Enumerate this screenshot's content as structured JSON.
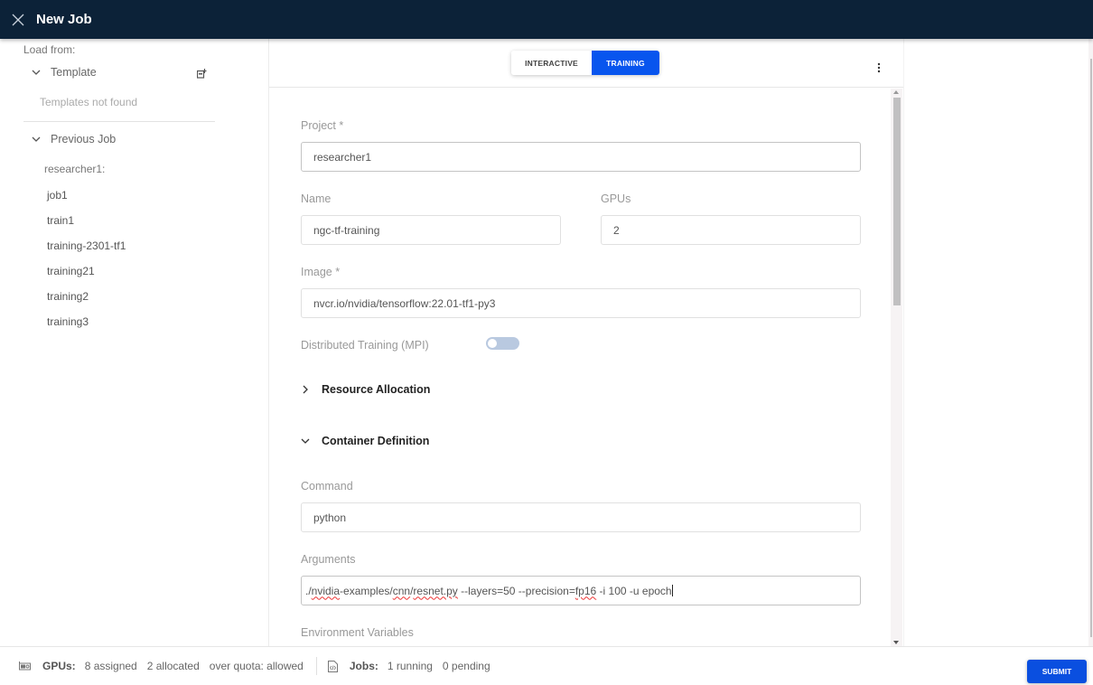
{
  "header": {
    "title": "New Job",
    "close_icon": "close-icon"
  },
  "left_panel": {
    "load_from_label": "Load from:",
    "template_section": {
      "label": "Template",
      "expanded": true,
      "action_icon": "add-template-icon",
      "empty_message": "Templates not found"
    },
    "previous_job_section": {
      "label": "Previous Job",
      "expanded": true,
      "owner_label": "researcher1:",
      "jobs": [
        "job1",
        "train1",
        "training-2301-tf1",
        "training21",
        "training2",
        "training3"
      ]
    }
  },
  "main": {
    "job_type_tabs": [
      {
        "label": "INTERACTIVE",
        "active": false
      },
      {
        "label": "TRAINING",
        "active": true
      }
    ],
    "more_menu_icon": "more-vertical-icon",
    "form": {
      "project": {
        "label": "Project *",
        "value": "researcher1"
      },
      "name": {
        "label": "Name",
        "value": "ngc-tf-training"
      },
      "gpus": {
        "label": "GPUs",
        "value": "2"
      },
      "image": {
        "label": "Image *",
        "value": "nvcr.io/nvidia/tensorflow:22.01-tf1-py3"
      },
      "distributed_training": {
        "label": "Distributed Training (MPI)",
        "enabled": false
      },
      "resource_allocation": {
        "label": "Resource Allocation",
        "expanded": false
      },
      "container_definition": {
        "label": "Container Definition",
        "expanded": true
      },
      "command": {
        "label": "Command",
        "value": "python"
      },
      "arguments": {
        "label": "Arguments",
        "value": "./nvidia-examples/cnn/resnet.py --layers=50 --precision=fp16 -i 100 -u epoch",
        "parts": {
          "p1": "./",
          "p2": "nvidia",
          "p3": "-examples/",
          "p4": "cnn",
          "p5": "/",
          "p6": "resnet.py",
          "p7": " --layers=50 --precision=",
          "p8": "fp16",
          "p9": " -i 100 -u epoch"
        }
      },
      "environment_variables": {
        "label": "Environment Variables"
      }
    }
  },
  "footer": {
    "gpus": {
      "icon": "gpu-card-icon",
      "label": "GPUs:",
      "assigned": "8 assigned",
      "allocated": "2 allocated",
      "over_quota": "over quota: allowed"
    },
    "jobs": {
      "icon": "code-file-icon",
      "label": "Jobs:",
      "running": "1 running",
      "pending": "0 pending"
    },
    "submit_label": "SUBMIT"
  },
  "colors": {
    "header_bg": "#0c2238",
    "accent": "#0855ee",
    "toggle_off": "#b9c9e0"
  }
}
